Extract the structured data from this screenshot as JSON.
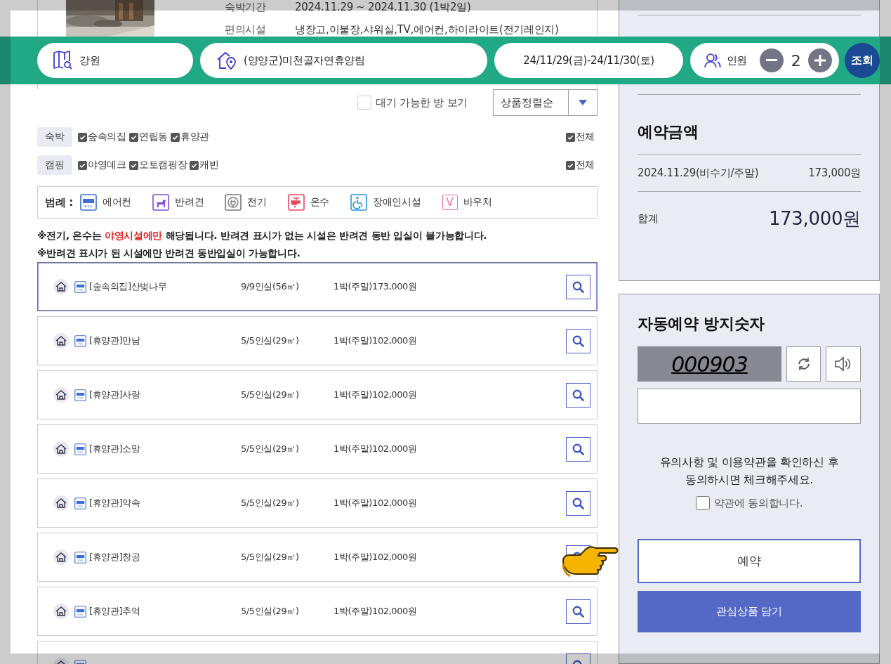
{
  "room_info": {
    "rows": [
      {
        "label": "숙박기간",
        "value": "2024.11.29 ~ 2024.11.30 (1박2일)"
      },
      {
        "label": "편의시설",
        "value": "냉장고,이불장,샤워실,TV,에어컨,하이라이트(전기레인지)"
      }
    ]
  },
  "search_bar": {
    "region": "강원",
    "site": "(양양군)미천골자연휴양림",
    "dates": "24/11/29(금)-24/11/30(토)",
    "people_label": "인원",
    "count": "2",
    "submit": "조회"
  },
  "toolbar": {
    "waitlist": {
      "label": "대기 가능한 방 보기",
      "checked": false
    },
    "sort": {
      "value": "상품정렬순"
    }
  },
  "filter_groups": [
    {
      "name": "숙박",
      "options": [
        {
          "label": "숲속의집",
          "checked": true
        },
        {
          "label": "연립동",
          "checked": true
        },
        {
          "label": "휴양관",
          "checked": true
        }
      ],
      "all": {
        "label": "전체",
        "checked": true
      }
    },
    {
      "name": "캠핑",
      "options": [
        {
          "label": "야영데크",
          "checked": true
        },
        {
          "label": "오토캠핑장",
          "checked": true
        },
        {
          "label": "캐빈",
          "checked": true
        }
      ],
      "all": {
        "label": "전체",
        "checked": true
      }
    }
  ],
  "legend": {
    "title": "범례 :",
    "items": [
      {
        "kind": "aircon",
        "label": "에어컨"
      },
      {
        "kind": "pet",
        "label": "반려견"
      },
      {
        "kind": "electric",
        "label": "전기"
      },
      {
        "kind": "hotwater",
        "label": "온수"
      },
      {
        "kind": "accessible",
        "label": "장애인시설"
      },
      {
        "kind": "voucher",
        "label": "바우처",
        "glyph": "V"
      }
    ]
  },
  "notices": [
    {
      "parts": [
        {
          "text": "※전기, 온수는 ",
          "emphasis": false
        },
        {
          "text": "야영시설에만",
          "emphasis": true
        },
        {
          "text": " 해당됩니다. 반려견 표시가 없는 시설은 반려견 동반 입실이 불가능합니다.",
          "emphasis": false
        }
      ]
    },
    {
      "parts": [
        {
          "text": "※반려견 표시가 된 시설에만 반려견 동반입실이 가능합니다.",
          "emphasis": false
        }
      ]
    }
  ],
  "rooms": [
    {
      "name": "[숲속의집]산벚나무",
      "capacity": "9/9인실(56㎡)",
      "price": "1박(주말)173,000원",
      "facilities": [
        {
          "kind": "aircon"
        }
      ],
      "selected": true
    },
    {
      "name": "[휴양관]만남",
      "capacity": "5/5인실(29㎡)",
      "price": "1박(주말)102,000원",
      "facilities": [
        {
          "kind": "aircon"
        }
      ],
      "selected": false
    },
    {
      "name": "[휴양관]사랑",
      "capacity": "5/5인실(29㎡)",
      "price": "1박(주말)102,000원",
      "facilities": [
        {
          "kind": "aircon"
        }
      ],
      "selected": false
    },
    {
      "name": "[휴양관]소망",
      "capacity": "5/5인실(29㎡)",
      "price": "1박(주말)102,000원",
      "facilities": [
        {
          "kind": "aircon"
        }
      ],
      "selected": false
    },
    {
      "name": "[휴양관]약속",
      "capacity": "5/5인실(29㎡)",
      "price": "1박(주말)102,000원",
      "facilities": [
        {
          "kind": "aircon"
        }
      ],
      "selected": false
    },
    {
      "name": "[휴양관]창공",
      "capacity": "5/5인실(29㎡)",
      "price": "1박(주말)102,000원",
      "facilities": [
        {
          "kind": "aircon"
        }
      ],
      "selected": false
    },
    {
      "name": "[휴양관]추억",
      "capacity": "5/5인실(29㎡)",
      "price": "1박(주말)102,000원",
      "facilities": [
        {
          "kind": "aircon"
        }
      ],
      "selected": false
    },
    {
      "facilities": [
        {
          "kind": "aircon"
        }
      ],
      "selected": false
    }
  ],
  "summary": {
    "title": "예약금액",
    "lines": [
      {
        "label": "2024.11.29(비수기/주말)",
        "amount": "173,000원"
      }
    ],
    "total": {
      "label": "합계",
      "amount": "173,000원"
    }
  },
  "captcha": {
    "title": "자동예약 방지숫자",
    "code": "000903",
    "notice": "유의사항 및 이용약관을 확인하신 후\n동의하시면 체크해주세요.",
    "agree": {
      "label": "약관에 동의합니다.",
      "checked": false
    },
    "reserve_button": "예약",
    "wishlist_button": "관심상품 담기"
  }
}
